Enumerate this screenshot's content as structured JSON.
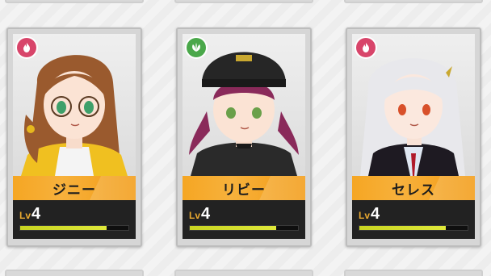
{
  "characters": [
    {
      "name": "ジニー",
      "level_label": "Lv",
      "level": "4",
      "exp_fraction": 0.8,
      "element_icon": "flame-element-icon",
      "element_color": "#d8456a",
      "hair_color": "#9a5a2e",
      "eye_color": "#3ea06a",
      "outfit_color": "#f0c020"
    },
    {
      "name": "リビー",
      "level_label": "Lv",
      "level": "4",
      "exp_fraction": 0.8,
      "element_icon": "leaf-element-icon",
      "element_color": "#4aa84a",
      "hair_color": "#8a2a5a",
      "eye_color": "#6aa04a",
      "outfit_color": "#2a2a2a"
    },
    {
      "name": "セレス",
      "level_label": "Lv",
      "level": "4",
      "exp_fraction": 0.8,
      "element_icon": "flame-element-icon",
      "element_color": "#d8456a",
      "hair_color": "#e8e8ec",
      "eye_color": "#d8502a",
      "outfit_color": "#1e1a22"
    }
  ]
}
